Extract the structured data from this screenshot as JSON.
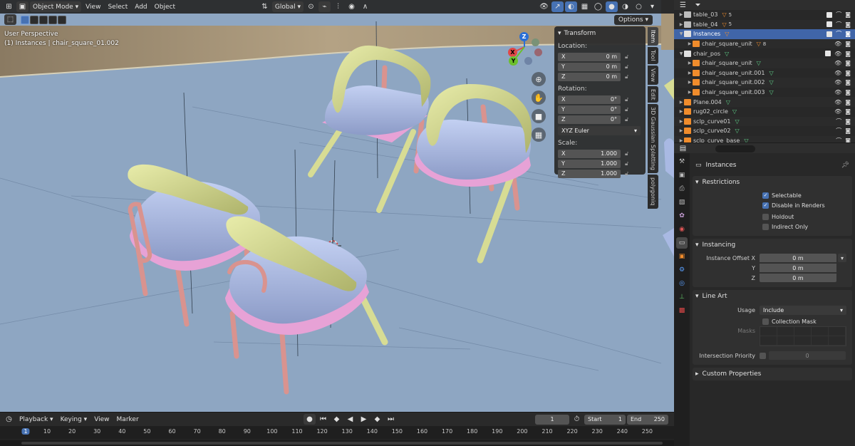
{
  "viewport": {
    "header": {
      "mode": "Object Mode",
      "menus": [
        "View",
        "Select",
        "Add",
        "Object"
      ],
      "orientation": "Global",
      "options_label": "Options"
    },
    "info": {
      "perspective": "User Perspective",
      "active": "(1) Instances | chair_square_01.002"
    },
    "gizmo_axes": [
      "X",
      "Y",
      "Z"
    ],
    "tabs": [
      "Item",
      "Tool",
      "View",
      "Edit",
      "3D Gaussian Splatting",
      "polygoniq"
    ],
    "transform": {
      "title": "Transform",
      "location_label": "Location:",
      "location": [
        {
          "axis": "X",
          "value": "0 m"
        },
        {
          "axis": "Y",
          "value": "0 m"
        },
        {
          "axis": "Z",
          "value": "0 m"
        }
      ],
      "rotation_label": "Rotation:",
      "rotation": [
        {
          "axis": "X",
          "value": "0°"
        },
        {
          "axis": "Y",
          "value": "0°"
        },
        {
          "axis": "Z",
          "value": "0°"
        }
      ],
      "rotation_mode": "XYZ Euler",
      "scale_label": "Scale:",
      "scale": [
        {
          "axis": "X",
          "value": "1.000"
        },
        {
          "axis": "Y",
          "value": "1.000"
        },
        {
          "axis": "Z",
          "value": "1.000"
        }
      ]
    },
    "colors": {
      "background": "#8ea6c2",
      "floor": "#8ca3c0",
      "seat": "#a9b9e3",
      "backrest": "#d7dc94",
      "legs": "#d9938f",
      "frame": "#e7a2d6"
    }
  },
  "timeline": {
    "menus": [
      "Playback",
      "Keying",
      "View",
      "Marker"
    ],
    "current_frame": "1",
    "start_label": "Start",
    "start": "1",
    "end_label": "End",
    "end": "250",
    "ruler": [
      "1",
      "10",
      "20",
      "30",
      "40",
      "50",
      "60",
      "70",
      "80",
      "90",
      "100",
      "110",
      "120",
      "130",
      "140",
      "150",
      "160",
      "170",
      "180",
      "190",
      "200",
      "210",
      "220",
      "230",
      "240",
      "250"
    ]
  },
  "outliner": {
    "rows": [
      {
        "name": "table_03",
        "depth": 1,
        "badge": "5",
        "selected": false
      },
      {
        "name": "table_04",
        "depth": 1,
        "badge": "5",
        "selected": false
      },
      {
        "name": "Instances",
        "depth": 1,
        "badge": "",
        "selected": true
      },
      {
        "name": "chair_square_unit",
        "depth": 2,
        "badge": "8",
        "selected": false
      },
      {
        "name": "chair_pos",
        "depth": 1,
        "badge": "",
        "selected": false
      },
      {
        "name": "chair_square_unit",
        "depth": 2,
        "badge": "",
        "selected": false
      },
      {
        "name": "chair_square_unit.001",
        "depth": 2,
        "badge": "",
        "selected": false
      },
      {
        "name": "chair_square_unit.002",
        "depth": 2,
        "badge": "",
        "selected": false
      },
      {
        "name": "chair_square_unit.003",
        "depth": 2,
        "badge": "",
        "selected": false
      },
      {
        "name": "Plane.004",
        "depth": 1,
        "badge": "",
        "selected": false
      },
      {
        "name": "rug02_circle",
        "depth": 1,
        "badge": "",
        "selected": false
      },
      {
        "name": "sclp_curve01",
        "depth": 1,
        "badge": "",
        "selected": false
      },
      {
        "name": "sclp_curve02",
        "depth": 1,
        "badge": "",
        "selected": false
      },
      {
        "name": "sclp_curve_base",
        "depth": 1,
        "badge": "",
        "selected": false
      }
    ]
  },
  "properties": {
    "object_name": "Instances",
    "restrictions": {
      "title": "Restrictions",
      "selectable": "Selectable",
      "disable_renders": "Disable in Renders",
      "holdout": "Holdout",
      "indirect_only": "Indirect Only"
    },
    "instancing": {
      "title": "Instancing",
      "offset_label": "Instance Offset X",
      "y_label": "Y",
      "z_label": "Z",
      "x": "0 m",
      "y": "0 m",
      "z": "0 m"
    },
    "line_art": {
      "title": "Line Art",
      "usage_label": "Usage",
      "usage": "Include",
      "collection_mask": "Collection Mask",
      "masks_label": "Masks",
      "priority_label": "Intersection Priority",
      "priority": "0"
    },
    "custom_properties": "Custom Properties"
  }
}
